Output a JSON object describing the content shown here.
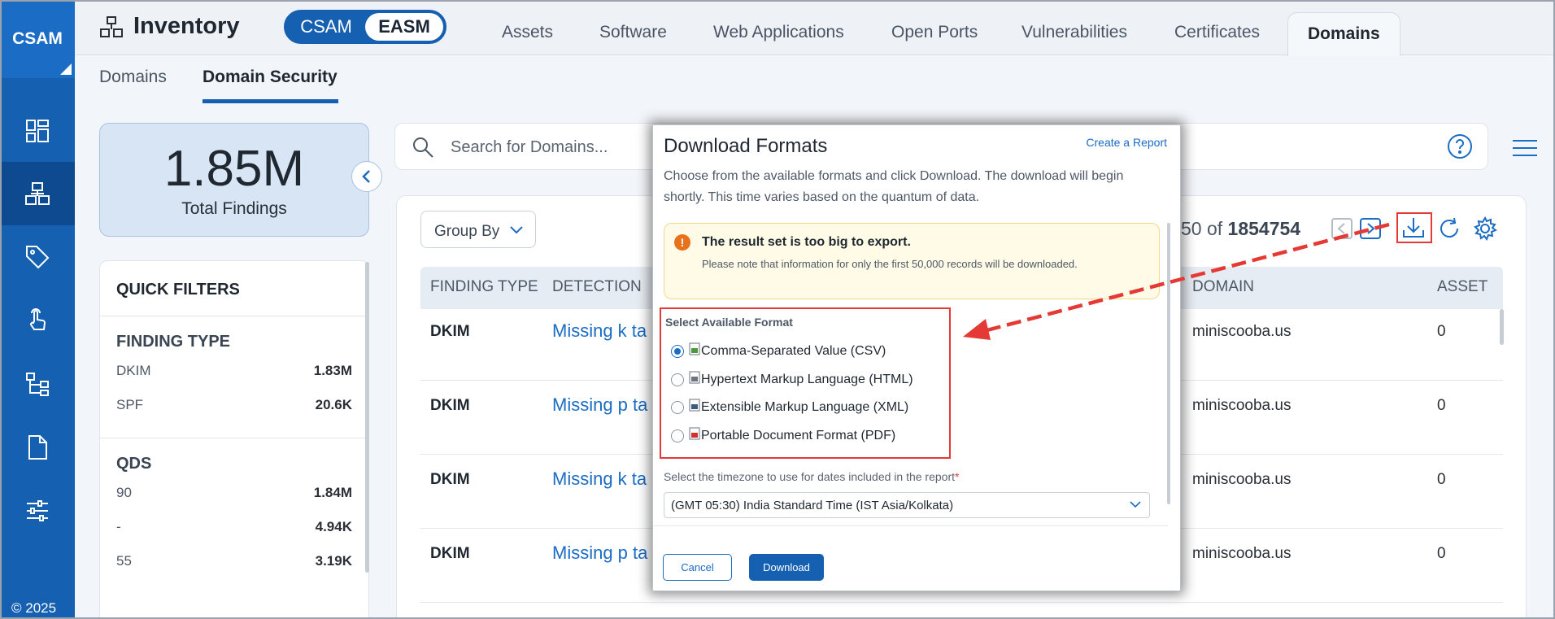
{
  "sidebar": {
    "brand": "CSAM",
    "items": [
      {
        "icon": "dashboard-icon"
      },
      {
        "icon": "inventory-icon",
        "active": true
      },
      {
        "icon": "tag-icon"
      },
      {
        "icon": "touch-icon"
      },
      {
        "icon": "hierarchy-icon"
      },
      {
        "icon": "document-icon"
      },
      {
        "icon": "sliders-icon"
      }
    ],
    "copyright": "© 2025"
  },
  "header": {
    "title": "Inventory",
    "toggle": {
      "left": "CSAM",
      "right": "EASM",
      "selected": "EASM"
    },
    "tabs": [
      "Assets",
      "Software",
      "Web Applications",
      "Open Ports",
      "Vulnerabilities",
      "Certificates",
      "Domains"
    ],
    "active_tab": "Domains"
  },
  "subtabs": {
    "items": [
      "Domains",
      "Domain Security"
    ],
    "active": "Domain Security"
  },
  "summary": {
    "value": "1.85M",
    "label": "Total Findings"
  },
  "quick_filters": {
    "title": "QUICK FILTERS",
    "finding_type": {
      "title": "FINDING TYPE",
      "rows": [
        {
          "label": "DKIM",
          "count": "1.83M"
        },
        {
          "label": "SPF",
          "count": "20.6K"
        }
      ]
    },
    "qds": {
      "title": "QDS",
      "rows": [
        {
          "label": "90",
          "count": "1.84M"
        },
        {
          "label": "-",
          "count": "4.94K"
        },
        {
          "label": "55",
          "count": "3.19K"
        }
      ]
    }
  },
  "search": {
    "placeholder": "Search for Domains..."
  },
  "toolbar": {
    "group_by": "Group By",
    "pager_partial": "50 of",
    "pager_total": "1854754"
  },
  "table": {
    "headers": {
      "finding_type": "FINDING TYPE",
      "detection": "DETECTION",
      "domain": "DOMAIN",
      "asset": "ASSET"
    },
    "rows": [
      {
        "type": "DKIM",
        "detection": "Missing k ta",
        "domain": "miniscooba.us",
        "asset": "0"
      },
      {
        "type": "DKIM",
        "detection": "Missing p ta",
        "domain": "miniscooba.us",
        "asset": "0"
      },
      {
        "type": "DKIM",
        "detection": "Missing k ta",
        "domain": "miniscooba.us",
        "asset": "0"
      },
      {
        "type": "DKIM",
        "detection": "Missing p ta",
        "domain": "miniscooba.us",
        "asset": "0"
      }
    ]
  },
  "dialog": {
    "title": "Download Formats",
    "link": "Create a Report",
    "description": "Choose from the available formats and click Download. The download will begin shortly. This time varies based on the quantum of data.",
    "warning_title": "The result set is too big to export.",
    "warning_text": "Please note that information for only the first 50,000 records will be downloaded.",
    "format_title": "Select Available Format",
    "formats": [
      {
        "label": "Comma-Separated Value (CSV)",
        "checked": true,
        "color": "#4a9a3a"
      },
      {
        "label": "Hypertext Markup Language (HTML)",
        "checked": false,
        "color": "#6b7480"
      },
      {
        "label": "Extensible Markup Language (XML)",
        "checked": false,
        "color": "#3d5a80"
      },
      {
        "label": "Portable Document Format (PDF)",
        "checked": false,
        "color": "#d32f2f"
      }
    ],
    "timezone_label": "Select the timezone to use for dates included in the report",
    "timezone_required": "*",
    "timezone_value": "(GMT 05:30) India Standard Time (IST Asia/Kolkata)",
    "cancel_label": "Cancel",
    "download_label": "Download"
  },
  "colors": {
    "primary": "#1560b0",
    "annotation": "#e53935",
    "link": "#1a6cc4"
  }
}
